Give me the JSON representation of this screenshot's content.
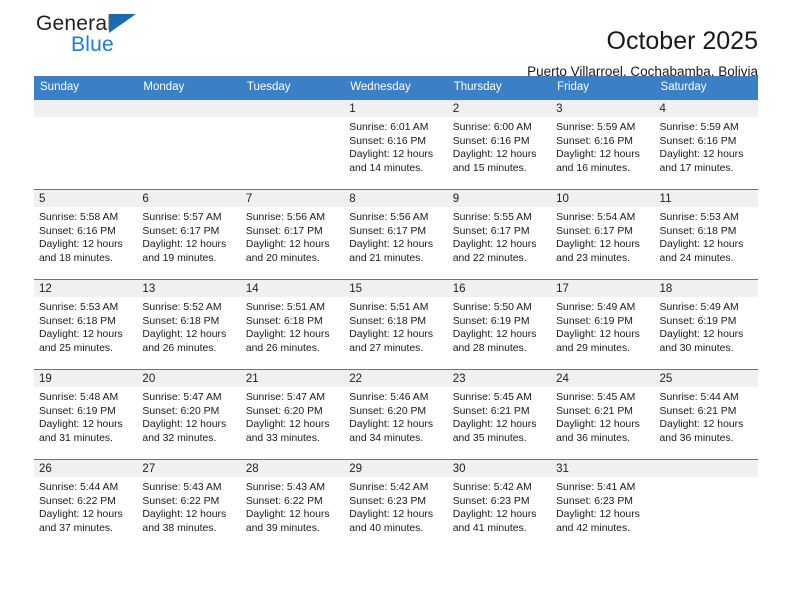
{
  "brand": {
    "line1": "General",
    "line2": "Blue",
    "triangle_color": "#1b6ab3",
    "blue_color": "#1b7fd4"
  },
  "header": {
    "title": "October 2025",
    "subtitle": "Puerto Villarroel, Cochabamba, Bolivia"
  },
  "theme": {
    "header_blue": "#3b7fc4",
    "daynum_gray": "#f0f0f0"
  },
  "calendar": {
    "weekday_headers": [
      "Sunday",
      "Monday",
      "Tuesday",
      "Wednesday",
      "Thursday",
      "Friday",
      "Saturday"
    ],
    "weeks": [
      [
        {
          "day": "",
          "sunrise": "",
          "sunset": "",
          "daylight1": "",
          "daylight2": ""
        },
        {
          "day": "",
          "sunrise": "",
          "sunset": "",
          "daylight1": "",
          "daylight2": ""
        },
        {
          "day": "",
          "sunrise": "",
          "sunset": "",
          "daylight1": "",
          "daylight2": ""
        },
        {
          "day": "1",
          "sunrise": "Sunrise: 6:01 AM",
          "sunset": "Sunset: 6:16 PM",
          "daylight1": "Daylight: 12 hours",
          "daylight2": "and 14 minutes."
        },
        {
          "day": "2",
          "sunrise": "Sunrise: 6:00 AM",
          "sunset": "Sunset: 6:16 PM",
          "daylight1": "Daylight: 12 hours",
          "daylight2": "and 15 minutes."
        },
        {
          "day": "3",
          "sunrise": "Sunrise: 5:59 AM",
          "sunset": "Sunset: 6:16 PM",
          "daylight1": "Daylight: 12 hours",
          "daylight2": "and 16 minutes."
        },
        {
          "day": "4",
          "sunrise": "Sunrise: 5:59 AM",
          "sunset": "Sunset: 6:16 PM",
          "daylight1": "Daylight: 12 hours",
          "daylight2": "and 17 minutes."
        }
      ],
      [
        {
          "day": "5",
          "sunrise": "Sunrise: 5:58 AM",
          "sunset": "Sunset: 6:16 PM",
          "daylight1": "Daylight: 12 hours",
          "daylight2": "and 18 minutes."
        },
        {
          "day": "6",
          "sunrise": "Sunrise: 5:57 AM",
          "sunset": "Sunset: 6:17 PM",
          "daylight1": "Daylight: 12 hours",
          "daylight2": "and 19 minutes."
        },
        {
          "day": "7",
          "sunrise": "Sunrise: 5:56 AM",
          "sunset": "Sunset: 6:17 PM",
          "daylight1": "Daylight: 12 hours",
          "daylight2": "and 20 minutes."
        },
        {
          "day": "8",
          "sunrise": "Sunrise: 5:56 AM",
          "sunset": "Sunset: 6:17 PM",
          "daylight1": "Daylight: 12 hours",
          "daylight2": "and 21 minutes."
        },
        {
          "day": "9",
          "sunrise": "Sunrise: 5:55 AM",
          "sunset": "Sunset: 6:17 PM",
          "daylight1": "Daylight: 12 hours",
          "daylight2": "and 22 minutes."
        },
        {
          "day": "10",
          "sunrise": "Sunrise: 5:54 AM",
          "sunset": "Sunset: 6:17 PM",
          "daylight1": "Daylight: 12 hours",
          "daylight2": "and 23 minutes."
        },
        {
          "day": "11",
          "sunrise": "Sunrise: 5:53 AM",
          "sunset": "Sunset: 6:18 PM",
          "daylight1": "Daylight: 12 hours",
          "daylight2": "and 24 minutes."
        }
      ],
      [
        {
          "day": "12",
          "sunrise": "Sunrise: 5:53 AM",
          "sunset": "Sunset: 6:18 PM",
          "daylight1": "Daylight: 12 hours",
          "daylight2": "and 25 minutes."
        },
        {
          "day": "13",
          "sunrise": "Sunrise: 5:52 AM",
          "sunset": "Sunset: 6:18 PM",
          "daylight1": "Daylight: 12 hours",
          "daylight2": "and 26 minutes."
        },
        {
          "day": "14",
          "sunrise": "Sunrise: 5:51 AM",
          "sunset": "Sunset: 6:18 PM",
          "daylight1": "Daylight: 12 hours",
          "daylight2": "and 26 minutes."
        },
        {
          "day": "15",
          "sunrise": "Sunrise: 5:51 AM",
          "sunset": "Sunset: 6:18 PM",
          "daylight1": "Daylight: 12 hours",
          "daylight2": "and 27 minutes."
        },
        {
          "day": "16",
          "sunrise": "Sunrise: 5:50 AM",
          "sunset": "Sunset: 6:19 PM",
          "daylight1": "Daylight: 12 hours",
          "daylight2": "and 28 minutes."
        },
        {
          "day": "17",
          "sunrise": "Sunrise: 5:49 AM",
          "sunset": "Sunset: 6:19 PM",
          "daylight1": "Daylight: 12 hours",
          "daylight2": "and 29 minutes."
        },
        {
          "day": "18",
          "sunrise": "Sunrise: 5:49 AM",
          "sunset": "Sunset: 6:19 PM",
          "daylight1": "Daylight: 12 hours",
          "daylight2": "and 30 minutes."
        }
      ],
      [
        {
          "day": "19",
          "sunrise": "Sunrise: 5:48 AM",
          "sunset": "Sunset: 6:19 PM",
          "daylight1": "Daylight: 12 hours",
          "daylight2": "and 31 minutes."
        },
        {
          "day": "20",
          "sunrise": "Sunrise: 5:47 AM",
          "sunset": "Sunset: 6:20 PM",
          "daylight1": "Daylight: 12 hours",
          "daylight2": "and 32 minutes."
        },
        {
          "day": "21",
          "sunrise": "Sunrise: 5:47 AM",
          "sunset": "Sunset: 6:20 PM",
          "daylight1": "Daylight: 12 hours",
          "daylight2": "and 33 minutes."
        },
        {
          "day": "22",
          "sunrise": "Sunrise: 5:46 AM",
          "sunset": "Sunset: 6:20 PM",
          "daylight1": "Daylight: 12 hours",
          "daylight2": "and 34 minutes."
        },
        {
          "day": "23",
          "sunrise": "Sunrise: 5:45 AM",
          "sunset": "Sunset: 6:21 PM",
          "daylight1": "Daylight: 12 hours",
          "daylight2": "and 35 minutes."
        },
        {
          "day": "24",
          "sunrise": "Sunrise: 5:45 AM",
          "sunset": "Sunset: 6:21 PM",
          "daylight1": "Daylight: 12 hours",
          "daylight2": "and 36 minutes."
        },
        {
          "day": "25",
          "sunrise": "Sunrise: 5:44 AM",
          "sunset": "Sunset: 6:21 PM",
          "daylight1": "Daylight: 12 hours",
          "daylight2": "and 36 minutes."
        }
      ],
      [
        {
          "day": "26",
          "sunrise": "Sunrise: 5:44 AM",
          "sunset": "Sunset: 6:22 PM",
          "daylight1": "Daylight: 12 hours",
          "daylight2": "and 37 minutes."
        },
        {
          "day": "27",
          "sunrise": "Sunrise: 5:43 AM",
          "sunset": "Sunset: 6:22 PM",
          "daylight1": "Daylight: 12 hours",
          "daylight2": "and 38 minutes."
        },
        {
          "day": "28",
          "sunrise": "Sunrise: 5:43 AM",
          "sunset": "Sunset: 6:22 PM",
          "daylight1": "Daylight: 12 hours",
          "daylight2": "and 39 minutes."
        },
        {
          "day": "29",
          "sunrise": "Sunrise: 5:42 AM",
          "sunset": "Sunset: 6:23 PM",
          "daylight1": "Daylight: 12 hours",
          "daylight2": "and 40 minutes."
        },
        {
          "day": "30",
          "sunrise": "Sunrise: 5:42 AM",
          "sunset": "Sunset: 6:23 PM",
          "daylight1": "Daylight: 12 hours",
          "daylight2": "and 41 minutes."
        },
        {
          "day": "31",
          "sunrise": "Sunrise: 5:41 AM",
          "sunset": "Sunset: 6:23 PM",
          "daylight1": "Daylight: 12 hours",
          "daylight2": "and 42 minutes."
        },
        {
          "day": "",
          "sunrise": "",
          "sunset": "",
          "daylight1": "",
          "daylight2": ""
        }
      ]
    ]
  }
}
